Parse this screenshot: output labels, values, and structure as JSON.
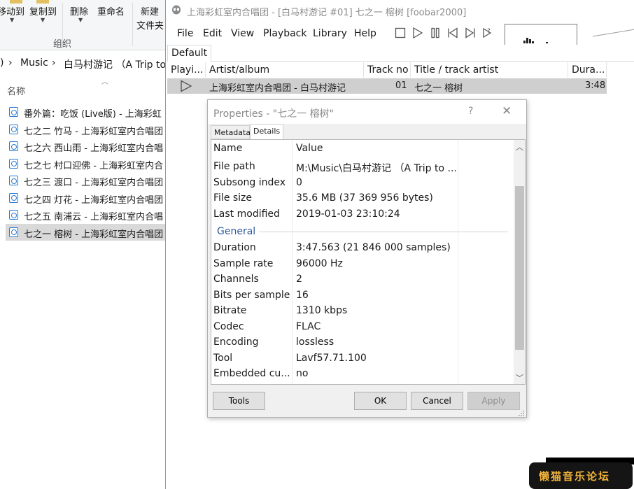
{
  "explorer": {
    "ribbon": {
      "move_to": "移动到",
      "copy_to": "复制到",
      "delete": "删除",
      "rename": "重命名",
      "new_top": "新建",
      "new_bottom": "文件夹",
      "group_label": "组织"
    },
    "breadcrumb": {
      "prefix": ")",
      "sep": "›",
      "music": "Music",
      "album": "白马村游记 （A Trip to"
    },
    "column_name": "名称",
    "files": [
      "番外篇：吃饭 (Live版) - 上海彩虹",
      "七之二 竹马 - 上海彩虹室内合唱团",
      "七之六 西山雨 - 上海彩虹室内合唱",
      "七之七 村口迎佛 - 上海彩虹室内合",
      "七之三 渡口 - 上海彩虹室内合唱团",
      "七之四 灯花 - 上海彩虹室内合唱团",
      "七之五 南浦云 - 上海彩虹室内合唱",
      "七之一 榕树 - 上海彩虹室内合唱团"
    ],
    "selected_index": 7
  },
  "foobar": {
    "title": "上海彩虹室内合唱团 - [白马村游记 #01] 七之一 榕树  [foobar2000]",
    "menu": [
      "File",
      "Edit",
      "View",
      "Playback",
      "Library",
      "Help"
    ],
    "toolbar_icons": [
      "stop-icon",
      "play-icon",
      "pause-icon",
      "previous-icon",
      "next-icon",
      "random-icon"
    ],
    "playlist_tab": "Default",
    "columns": [
      "Playi...",
      "Artist/album",
      "Track no",
      "Title / track artist",
      "Dura..."
    ],
    "row": {
      "artist_album": "上海彩虹室内合唱团 - 白马村游记",
      "track_no": "01",
      "title": "七之一 榕树",
      "duration": "3:48"
    }
  },
  "dialog": {
    "title": "Properties - \"七之一 榕树\"",
    "help": "?",
    "close": "✕",
    "tabs": [
      "Metadata",
      "Details"
    ],
    "active_tab": 1,
    "header": {
      "name": "Name",
      "value": "Value"
    },
    "location_rows": [
      {
        "name": "File path",
        "value": "M:\\Music\\白马村游记 （A Trip to ..."
      },
      {
        "name": "Subsong index",
        "value": "0"
      },
      {
        "name": "File size",
        "value": "35.6 MB (37 369 956 bytes)"
      },
      {
        "name": "Last modified",
        "value": "2019-01-03 23:10:24"
      }
    ],
    "group_general": "General",
    "general_rows": [
      {
        "name": "Duration",
        "value": "3:47.563 (21 846 000 samples)"
      },
      {
        "name": "Sample rate",
        "value": "96000 Hz"
      },
      {
        "name": "Channels",
        "value": "2"
      },
      {
        "name": "Bits per sample",
        "value": "16"
      },
      {
        "name": "Bitrate",
        "value": "1310 kbps"
      },
      {
        "name": "Codec",
        "value": "FLAC"
      },
      {
        "name": "Encoding",
        "value": "lossless"
      },
      {
        "name": "Tool",
        "value": "Lavf57.71.100"
      },
      {
        "name": "Embedded cu...",
        "value": "no"
      }
    ],
    "buttons": {
      "tools": "Tools",
      "ok": "OK",
      "cancel": "Cancel",
      "apply": "Apply"
    }
  },
  "watermark": "懒猫音乐论坛"
}
